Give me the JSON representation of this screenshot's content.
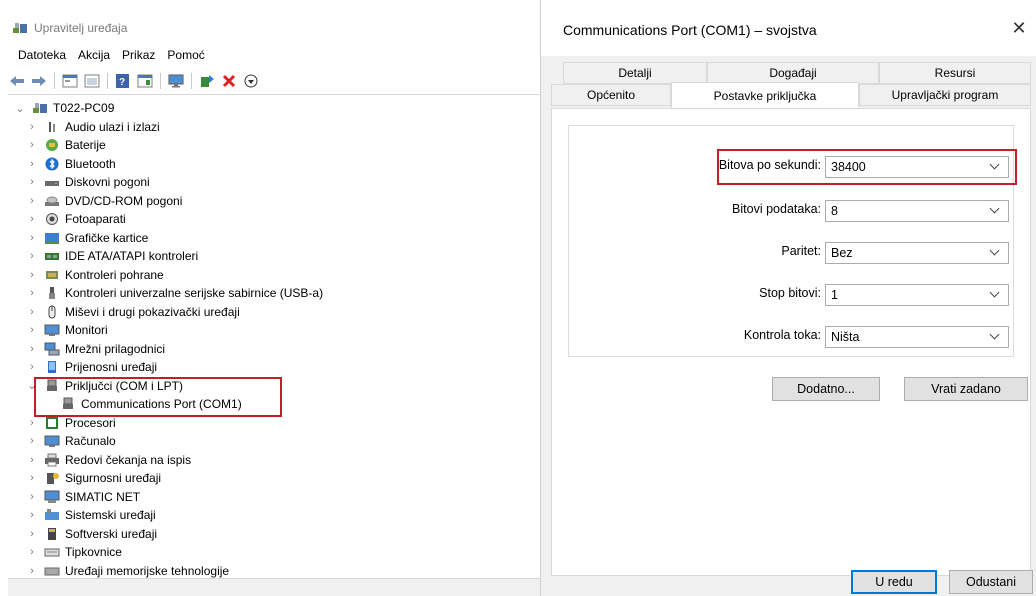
{
  "device_manager": {
    "title": "Upravitelj uređaja",
    "menu": [
      "Datoteka",
      "Akcija",
      "Prikaz",
      "Pomoć"
    ],
    "toolbar_icons": [
      "back-icon",
      "forward-icon",
      "properties-view-icon",
      "view-icon",
      "help-icon",
      "console-icon",
      "monitor-icon",
      "update-driver-icon",
      "uninstall-icon",
      "download-icon"
    ],
    "root": "T022-PC09",
    "tree": [
      {
        "label": "Audio ulazi i izlazi",
        "icon": "audio-icon"
      },
      {
        "label": "Baterije",
        "icon": "battery-icon"
      },
      {
        "label": "Bluetooth",
        "icon": "bluetooth-icon"
      },
      {
        "label": "Diskovni pogoni",
        "icon": "disk-drive-icon"
      },
      {
        "label": "DVD/CD-ROM pogoni",
        "icon": "dvd-icon"
      },
      {
        "label": "Fotoaparati",
        "icon": "camera-icon"
      },
      {
        "label": "Grafičke kartice",
        "icon": "display-adapter-icon"
      },
      {
        "label": "IDE ATA/ATAPI kontroleri",
        "icon": "ide-controller-icon"
      },
      {
        "label": "Kontroleri pohrane",
        "icon": "storage-controller-icon"
      },
      {
        "label": "Kontroleri univerzalne serijske sabirnice (USB-a)",
        "icon": "usb-icon"
      },
      {
        "label": "Miševi i drugi pokazivački uređaji",
        "icon": "mouse-icon"
      },
      {
        "label": "Monitori",
        "icon": "monitor-icon"
      },
      {
        "label": "Mrežni prilagodnici",
        "icon": "network-adapter-icon"
      },
      {
        "label": "Prijenosni uređaji",
        "icon": "portable-device-icon"
      },
      {
        "label": "Priključci (COM i LPT)",
        "icon": "port-icon",
        "expanded": true
      },
      {
        "label": "Communications Port (COM1)",
        "icon": "port-icon",
        "child": true
      },
      {
        "label": "Procesori",
        "icon": "processor-icon"
      },
      {
        "label": "Računalo",
        "icon": "computer-icon"
      },
      {
        "label": "Redovi čekanja na ispis",
        "icon": "printer-icon"
      },
      {
        "label": "Sigurnosni uređaji",
        "icon": "security-device-icon"
      },
      {
        "label": "SIMATIC NET",
        "icon": "network-icon"
      },
      {
        "label": "Sistemski uređaji",
        "icon": "system-device-icon"
      },
      {
        "label": "Softverski uređaji",
        "icon": "software-device-icon"
      },
      {
        "label": "Tipkovnice",
        "icon": "keyboard-icon"
      },
      {
        "label": "Uređaji memorijske tehnologije",
        "icon": "memory-device-icon"
      }
    ]
  },
  "dialog": {
    "title": "Communications Port (COM1) – svojstva",
    "close_glyph": "✕",
    "tabs_top": [
      "Detalji",
      "Događaji",
      "Resursi"
    ],
    "tabs_bottom": [
      "Općenito",
      "Postavke priključka",
      "Upravljački program"
    ],
    "active_tab": "Postavke priključka",
    "fields": [
      {
        "label": "Bitova po sekundi:",
        "value": "38400"
      },
      {
        "label": "Bitovi podataka:",
        "value": "8"
      },
      {
        "label": "Paritet:",
        "value": "Bez"
      },
      {
        "label": "Stop bitovi:",
        "value": "1"
      },
      {
        "label": "Kontrola toka:",
        "value": "Ništa"
      }
    ],
    "advanced_button": "Dodatno...",
    "restore_button": "Vrati zadano",
    "ok_button": "U redu",
    "cancel_button": "Odustani"
  },
  "colors": {
    "highlight_border": "#c0202a",
    "default_button_border": "#0078d7",
    "dialog_bg": "#f0f0f0"
  }
}
